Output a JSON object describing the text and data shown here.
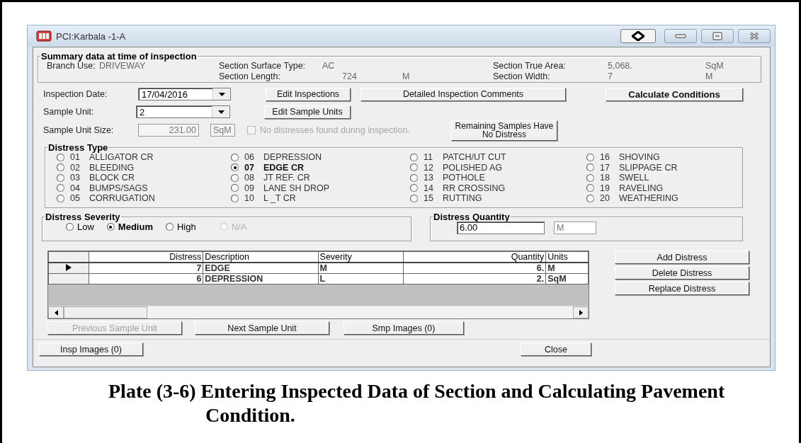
{
  "window": {
    "title": "PCI:Karbala -1-A"
  },
  "summary": {
    "title": "Summary data at time of inspection",
    "branch_use": {
      "label": "Branch Use:",
      "value": "DRIVEWAY"
    },
    "surface_type": {
      "label": "Section Surface Type:",
      "value": "AC"
    },
    "length": {
      "label": "Section Length:",
      "value": "724",
      "unit": "M"
    },
    "true_area": {
      "label": "Section True Area:",
      "value": "5,068.",
      "unit": "SqM"
    },
    "width": {
      "label": "Section Width:",
      "value": "7",
      "unit": "M"
    }
  },
  "inspection_date": {
    "label": "Inspection Date:",
    "value": "17/04/2016"
  },
  "sample_unit": {
    "label": "Sample Unit:",
    "value": "2"
  },
  "sample_unit_size": {
    "label": "Sample Unit Size:",
    "value": "231.00",
    "unit": "SqM"
  },
  "no_distress": {
    "label": "No distresses found during inspection.",
    "checked": false,
    "disabled": true
  },
  "edit_inspections_button": "Edit Inspections",
  "comments_button": "Detailed Inspection Comments",
  "calculate_button": "Calculate Conditions",
  "edit_sample_units_button": "Edit Sample Units",
  "remaining_button": "Remaining Samples Have No Distress",
  "distress_type": {
    "title": "Distress Type",
    "options": [
      {
        "code": "01",
        "name": "ALLIGATOR CR",
        "selected": false
      },
      {
        "code": "02",
        "name": "BLEEDING",
        "selected": false
      },
      {
        "code": "03",
        "name": "BLOCK CR",
        "selected": false
      },
      {
        "code": "04",
        "name": "BUMPS/SAGS",
        "selected": false
      },
      {
        "code": "05",
        "name": "CORRUGATION",
        "selected": false
      },
      {
        "code": "06",
        "name": "DEPRESSION",
        "selected": false
      },
      {
        "code": "07",
        "name": "EDGE CR",
        "selected": true
      },
      {
        "code": "08",
        "name": "JT REF. CR",
        "selected": false
      },
      {
        "code": "09",
        "name": "LANE SH DROP",
        "selected": false
      },
      {
        "code": "10",
        "name": "L _T CR",
        "selected": false
      },
      {
        "code": "11",
        "name": "PATCH/UT CUT",
        "selected": false
      },
      {
        "code": "12",
        "name": "POLISHED AG",
        "selected": false
      },
      {
        "code": "13",
        "name": "POTHOLE",
        "selected": false
      },
      {
        "code": "14",
        "name": "RR CROSSING",
        "selected": false
      },
      {
        "code": "15",
        "name": "RUTTING",
        "selected": false
      },
      {
        "code": "16",
        "name": "SHOVING",
        "selected": false
      },
      {
        "code": "17",
        "name": "SLIPPAGE CR",
        "selected": false
      },
      {
        "code": "18",
        "name": "SWELL",
        "selected": false
      },
      {
        "code": "19",
        "name": "RAVELING",
        "selected": false
      },
      {
        "code": "20",
        "name": "WEATHERING",
        "selected": false
      }
    ]
  },
  "distress_severity": {
    "title": "Distress Severity",
    "options": [
      {
        "label": "Low",
        "selected": false,
        "disabled": false
      },
      {
        "label": "Medium",
        "selected": true,
        "disabled": false
      },
      {
        "label": "High",
        "selected": false,
        "disabled": false
      },
      {
        "label": "N/A",
        "selected": false,
        "disabled": true
      }
    ]
  },
  "distress_quantity": {
    "title": "Distress Quantity",
    "value": "6.00",
    "unit": "M"
  },
  "table": {
    "columns": [
      "Distress",
      "Description",
      "Severity",
      "Quantity",
      "Units"
    ],
    "rows": [
      {
        "current": true,
        "cells": [
          "7",
          "EDGE",
          "M",
          "6.",
          "M"
        ]
      },
      {
        "current": false,
        "cells": [
          "6",
          "DEPRESSION",
          "L",
          "2.",
          "SqM"
        ]
      }
    ]
  },
  "side_buttons": [
    "Add Distress",
    "Delete Distress",
    "Replace Distress"
  ],
  "nav_buttons": [
    {
      "label": "Previous Sample Unit",
      "disabled": true
    },
    {
      "label": "Next Sample Unit",
      "disabled": false
    },
    {
      "label": "Smp Images (0)",
      "disabled": false
    }
  ],
  "insp_images_button": "Insp Images (0)",
  "close_button": "Close",
  "caption": "Plate (3-6) Entering Inspected Data of Section and Calculating Pavement Condition."
}
